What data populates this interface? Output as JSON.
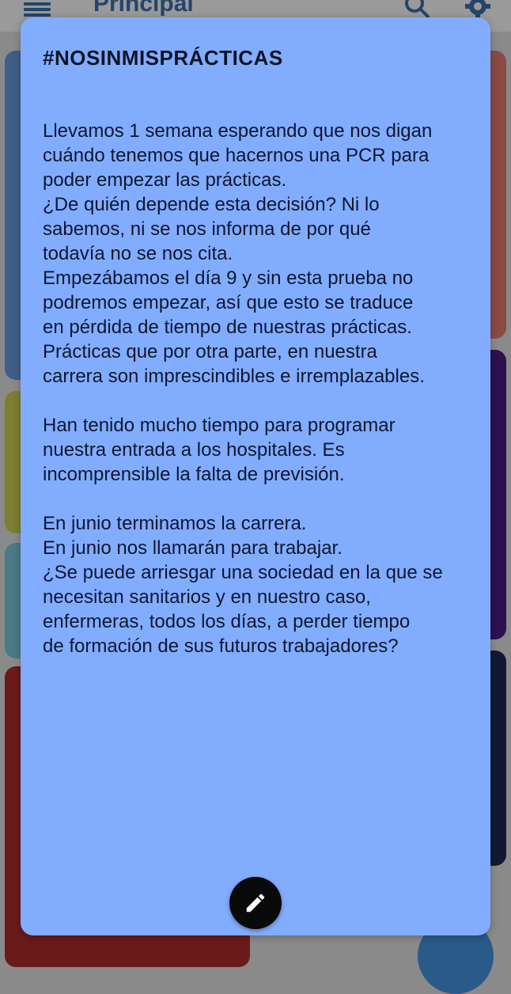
{
  "app": {
    "title": "Principal"
  },
  "note": {
    "title": "#NOSINMISPRÁCTICAS",
    "lines": [
      "Llevamos 1 semana esperando que nos digan",
      "cuándo tenemos que hacernos una PCR para",
      "poder empezar las prácticas.",
      "¿De quién depende esta decisión? Ni lo",
      "sabemos, ni se nos informa de por qué",
      "todavía no se nos cita.",
      "Empezábamos el día 9 y sin esta prueba no",
      "podremos empezar, así que esto se traduce",
      "en pérdida de tiempo de nuestras prácticas.",
      "Prácticas que por otra parte, en nuestra",
      "carrera son imprescindibles e irremplazables.",
      "",
      "Han tenido mucho tiempo para programar",
      "nuestra entrada a los hospitales. Es",
      "incomprensible la falta de previsión.",
      "",
      "En junio terminamos la carrera.",
      "En junio nos llamarán para trabajar.",
      "¿Se puede arriesgar una sociedad en la que se",
      "necesitan sanitarios y en nuestro caso,",
      "enfermeras, todos los días, a perder tiempo",
      "de formación de sus futuros trabajadores?"
    ]
  },
  "icons": {
    "menu": "menu-icon",
    "search": "search-icon",
    "settings": "gear-icon",
    "edit": "pencil-icon"
  },
  "colors": {
    "note_background": "#82adff",
    "app_accent": "#24456a",
    "fab": "#0a0a0a"
  }
}
